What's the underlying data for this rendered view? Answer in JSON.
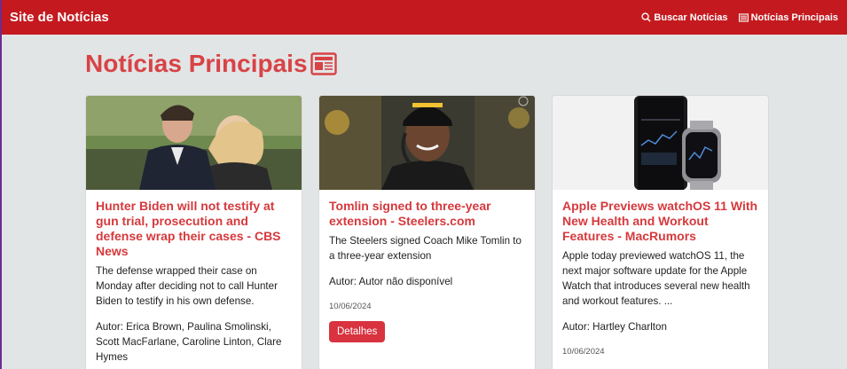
{
  "navbar": {
    "brand": "Site de Notícias",
    "search_label": "Buscar Notícias",
    "top_label": "Notícias Principais"
  },
  "page": {
    "title": "Notícias Principais"
  },
  "articles": [
    {
      "title": "Hunter Biden will not testify at gun trial, prosecution and defense wrap their cases - CBS News",
      "description": "The defense wrapped their case on Monday after deciding not to call Hunter Biden to testify in his own defense.",
      "author": "Autor: Erica Brown, Paulina Smolinski, Scott MacFarlane, Caroline Linton, Clare Hymes"
    },
    {
      "title": "Tomlin signed to three-year extension - Steelers.com",
      "description": "The Steelers signed Coach Mike Tomlin to a three-year extension",
      "author": "Autor: Autor não disponível",
      "date": "10/06/2024",
      "button": "Detalhes"
    },
    {
      "title": "Apple Previews watchOS 11 With New Health and Workout Features - MacRumors",
      "description": "Apple today previewed watchOS 11, the next major software update for the Apple Watch that introduces several new health and workout features. ...",
      "author": "Autor: Hartley Charlton",
      "date": "10/06/2024"
    }
  ],
  "colors": {
    "navbar": "#c41a1f",
    "accent": "#d6393d",
    "background": "#e2e5e6"
  }
}
